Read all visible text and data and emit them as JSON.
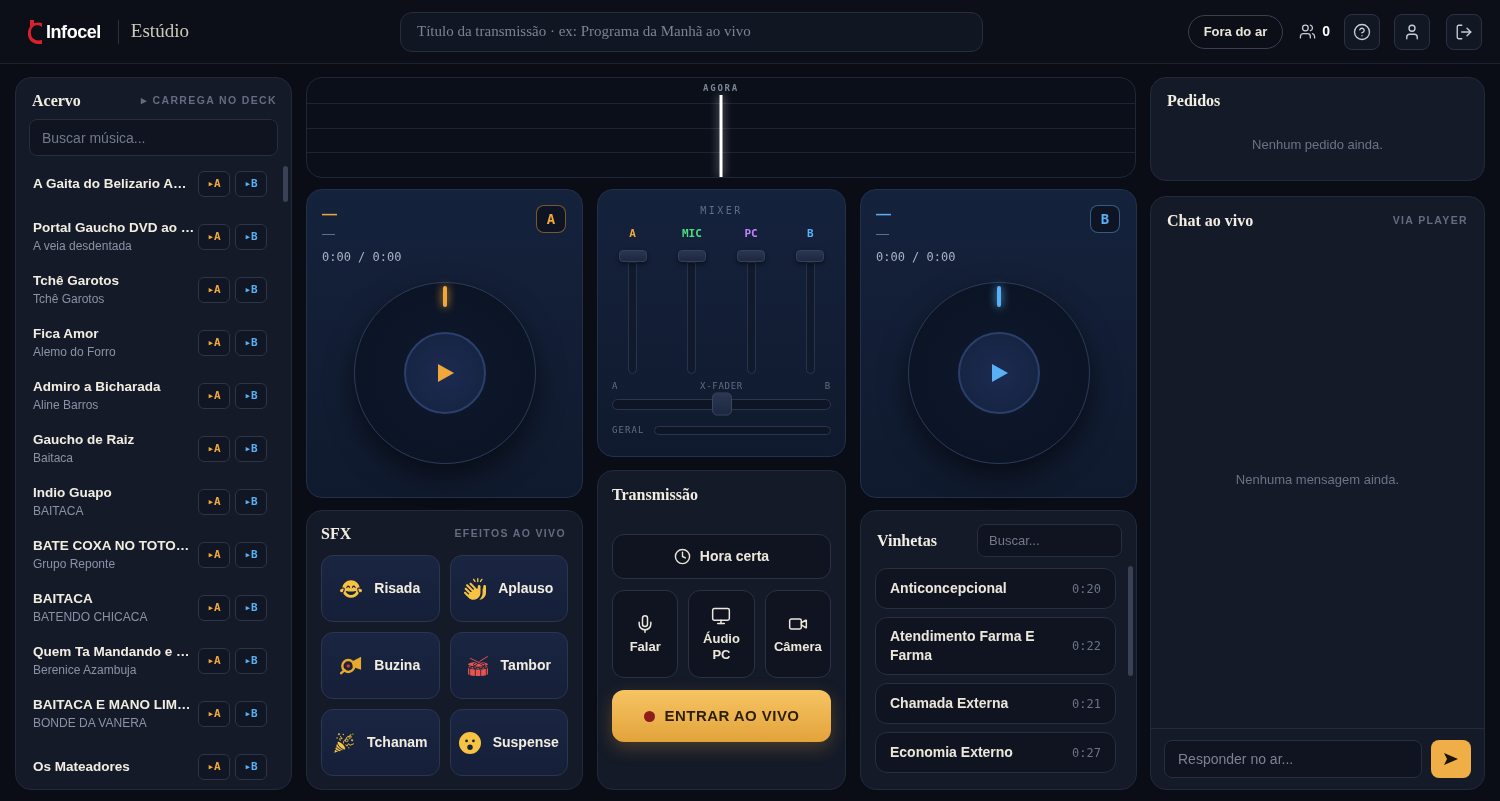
{
  "header": {
    "logo": "Infocel",
    "app_title": "Estúdio",
    "broadcast_title": {
      "placeholder": "Título da transmissão · ex: Programa da Manhã ao vivo"
    },
    "status_button": "Fora do ar",
    "listeners": "0"
  },
  "library": {
    "title": "Acervo",
    "hint": "▸ CARREGA NO DECK",
    "search": {
      "placeholder": "Buscar música..."
    },
    "tracks": [
      {
        "title": "A Gaita do Belizario A…",
        "deck_buttons": [
          {
            "label": "▸A",
            "color": "#f0a83a"
          },
          {
            "label": "▸B",
            "color": "#5ab0f5"
          }
        ]
      },
      {
        "title": "Portal Gaucho DVD ao …",
        "artist": "A veia desdentada",
        "deck_buttons": [
          {
            "label": "▸A",
            "color": "#f0a83a"
          },
          {
            "label": "▸B",
            "color": "#5ab0f5"
          }
        ]
      },
      {
        "title": "Tchê Garotos",
        "artist": "Tchê Garotos",
        "deck_buttons": [
          {
            "label": "▸A",
            "color": "#f0a83a"
          },
          {
            "label": "▸B",
            "color": "#5ab0f5"
          }
        ]
      },
      {
        "title": "Fica Amor",
        "artist": "Alemo do Forro",
        "deck_buttons": [
          {
            "label": "▸A",
            "color": "#f0a83a"
          },
          {
            "label": "▸B",
            "color": "#5ab0f5"
          }
        ]
      },
      {
        "title": "Admiro a Bicharada",
        "artist": "Aline Barros",
        "deck_buttons": [
          {
            "label": "▸A",
            "color": "#f0a83a"
          },
          {
            "label": "▸B",
            "color": "#5ab0f5"
          }
        ]
      },
      {
        "title": "Gaucho de Raiz",
        "artist": "Baitaca",
        "deck_buttons": [
          {
            "label": "▸A",
            "color": "#f0a83a"
          },
          {
            "label": "▸B",
            "color": "#5ab0f5"
          }
        ]
      },
      {
        "title": "Indio Guapo",
        "artist": "BAITACA",
        "deck_buttons": [
          {
            "label": "▸A",
            "color": "#f0a83a"
          },
          {
            "label": "▸B",
            "color": "#5ab0f5"
          }
        ]
      },
      {
        "title": "BATE COXA NO TOTO…",
        "artist": "Grupo Reponte",
        "deck_buttons": [
          {
            "label": "▸A",
            "color": "#f0a83a"
          },
          {
            "label": "▸B",
            "color": "#5ab0f5"
          }
        ]
      },
      {
        "title": "BAITACA",
        "artist": "BATENDO CHICACA",
        "deck_buttons": [
          {
            "label": "▸A",
            "color": "#f0a83a"
          },
          {
            "label": "▸B",
            "color": "#5ab0f5"
          }
        ]
      },
      {
        "title": "Quem Ta Mandando e …",
        "artist": "Berenice Azambuja",
        "deck_buttons": [
          {
            "label": "▸A",
            "color": "#f0a83a"
          },
          {
            "label": "▸B",
            "color": "#5ab0f5"
          }
        ]
      },
      {
        "title": "BAITACA E MANO LIM…",
        "artist": "BONDE DA VANERA",
        "deck_buttons": [
          {
            "label": "▸A",
            "color": "#f0a83a"
          },
          {
            "label": "▸B",
            "color": "#5ab0f5"
          }
        ]
      },
      {
        "title": "Os Mateadores",
        "deck_buttons": [
          {
            "label": "▸A",
            "color": "#f0a83a"
          },
          {
            "label": "▸B",
            "color": "#5ab0f5"
          }
        ]
      }
    ]
  },
  "timeline": {
    "now_label": "AGORA"
  },
  "decks": [
    {
      "title": "—",
      "artist": "—",
      "time": "0:00 / 0:00",
      "label": "A",
      "color": "#f0a83a"
    },
    {
      "title": "—",
      "artist": "—",
      "time": "0:00 / 0:00",
      "label": "B",
      "color": "#5ab0f5"
    }
  ],
  "mixer": {
    "title": "MIXER",
    "channels": [
      {
        "label": "A",
        "color": "#f0a83a",
        "level": 1
      },
      {
        "label": "MIC",
        "color": "#4ade80",
        "level": 1
      },
      {
        "label": "PC",
        "color": "#c084fc",
        "level": 1
      },
      {
        "label": "B",
        "color": "#5ab0f5",
        "level": 1
      }
    ],
    "crossfader": {
      "left_label": "A",
      "label": "X-FADER",
      "right_label": "B",
      "level": 0.5
    },
    "master": {
      "label": "GERAL"
    }
  },
  "broadcast": {
    "title": "Transmissão",
    "time_button": "Hora certa",
    "sources": [
      {
        "kind": "mic",
        "label": "Falar"
      },
      {
        "kind": "screen",
        "label": "Áudio PC"
      },
      {
        "kind": "camera",
        "label": "Câmera"
      }
    ],
    "go_live_button": "ENTRAR AO VIVO"
  },
  "sfx": {
    "title": "SFX",
    "hint": "EFEITOS AO VIVO",
    "effects": [
      {
        "kind": "laugh",
        "label": "Risada"
      },
      {
        "kind": "clap",
        "label": "Aplauso"
      },
      {
        "kind": "horn",
        "label": "Buzina"
      },
      {
        "kind": "drum",
        "label": "Tambor"
      },
      {
        "kind": "party",
        "label": "Tchanam"
      },
      {
        "kind": "scream",
        "label": "Suspense"
      }
    ]
  },
  "jingles": {
    "title": "Vinhetas",
    "search": {
      "placeholder": "Buscar..."
    },
    "items": [
      {
        "name": "Anticoncepcional",
        "duration": "0:20"
      },
      {
        "name": "Atendimento Farma E Farma",
        "duration": "0:22"
      },
      {
        "name": "Chamada Externa",
        "duration": "0:21"
      },
      {
        "name": "Economia Externo",
        "duration": "0:27"
      }
    ]
  },
  "requests": {
    "title": "Pedidos",
    "empty_text": "Nenhum pedido ainda."
  },
  "chat": {
    "title": "Chat ao vivo",
    "hint": "VIA PLAYER",
    "empty_text": "Nenhuma mensagem ainda.",
    "reply": {
      "placeholder": "Responder no ar..."
    }
  }
}
